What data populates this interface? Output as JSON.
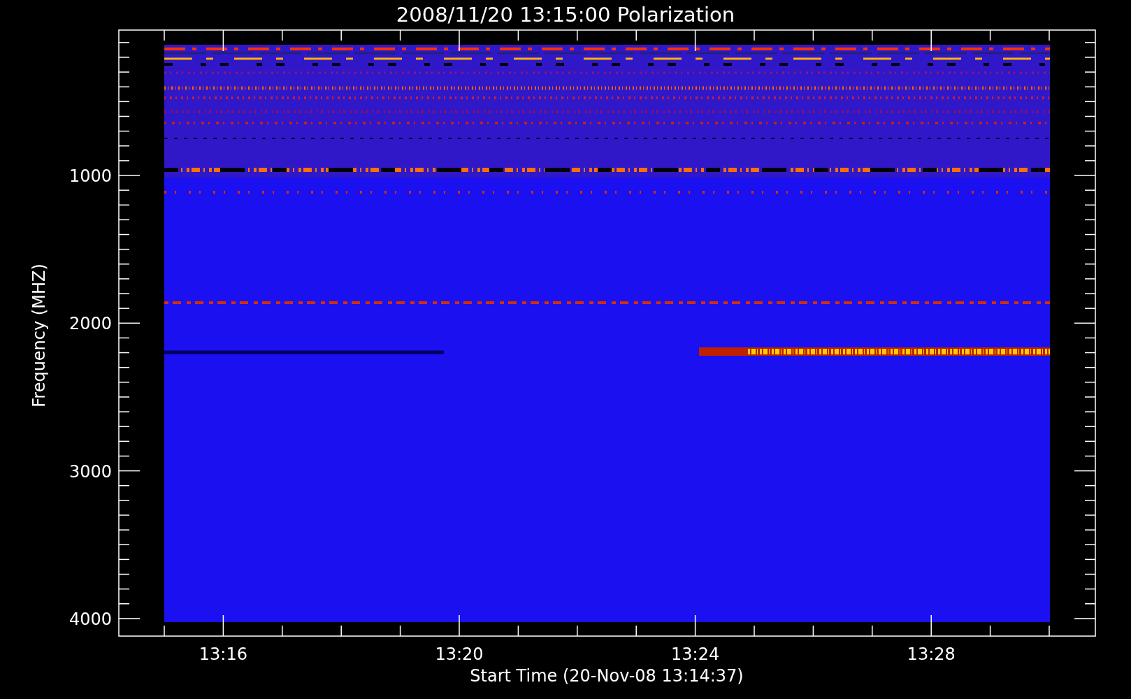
{
  "title": "2008/11/20 13:15:00 Polarization",
  "y_axis": {
    "label": "Frequency (MHZ)",
    "ticks": [
      "1000",
      "2000",
      "3000",
      "4000"
    ]
  },
  "x_axis": {
    "label": "Start Time (20-Nov-08 13:14:37)",
    "ticks": [
      "13:16",
      "13:20",
      "13:24",
      "13:28"
    ]
  }
}
